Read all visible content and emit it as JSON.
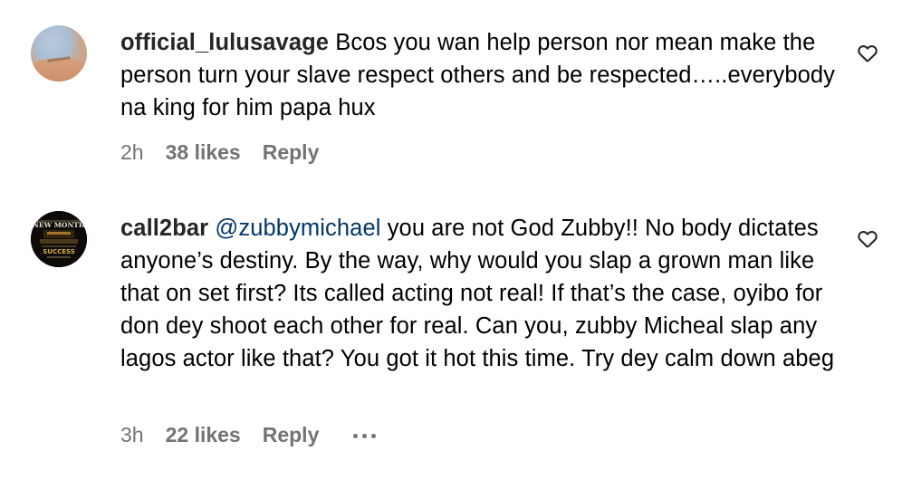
{
  "comments": [
    {
      "username": "official_lulusavage",
      "mention": "",
      "text": "Bcos you wan help person nor mean make the person turn your slave respect others and be respected…..everybody na king for him papa hux",
      "time": "2h",
      "likes": "38 likes",
      "reply_label": "Reply",
      "avatar_icon": "profile-photo-desert",
      "like_icon": "heart-outline-icon"
    },
    {
      "username": "call2bar",
      "mention": "@zubbymichael",
      "text": "you are not God Zubby!! No body dictates anyone’s destiny. By the way, why would you slap a grown man like that on set first? Its called acting not real! If that’s the case, oyibo for don dey shoot each other for real. Can you, zubby Micheal slap any lagos actor like that? You got it hot this time. Try dey calm down abeg",
      "time": "3h",
      "likes": "22 likes",
      "reply_label": "Reply",
      "avatar_icon": "profile-photo-new-month-poster",
      "more_icon": "more-options-ellipsis-icon",
      "like_icon": "heart-outline-icon"
    }
  ],
  "avatar_text": {
    "line1": "NEW MONTH",
    "line2": "SUCCESS"
  },
  "colors": {
    "username": "#262626",
    "mention": "#00376b",
    "meta": "#737373",
    "body": "#000000"
  }
}
